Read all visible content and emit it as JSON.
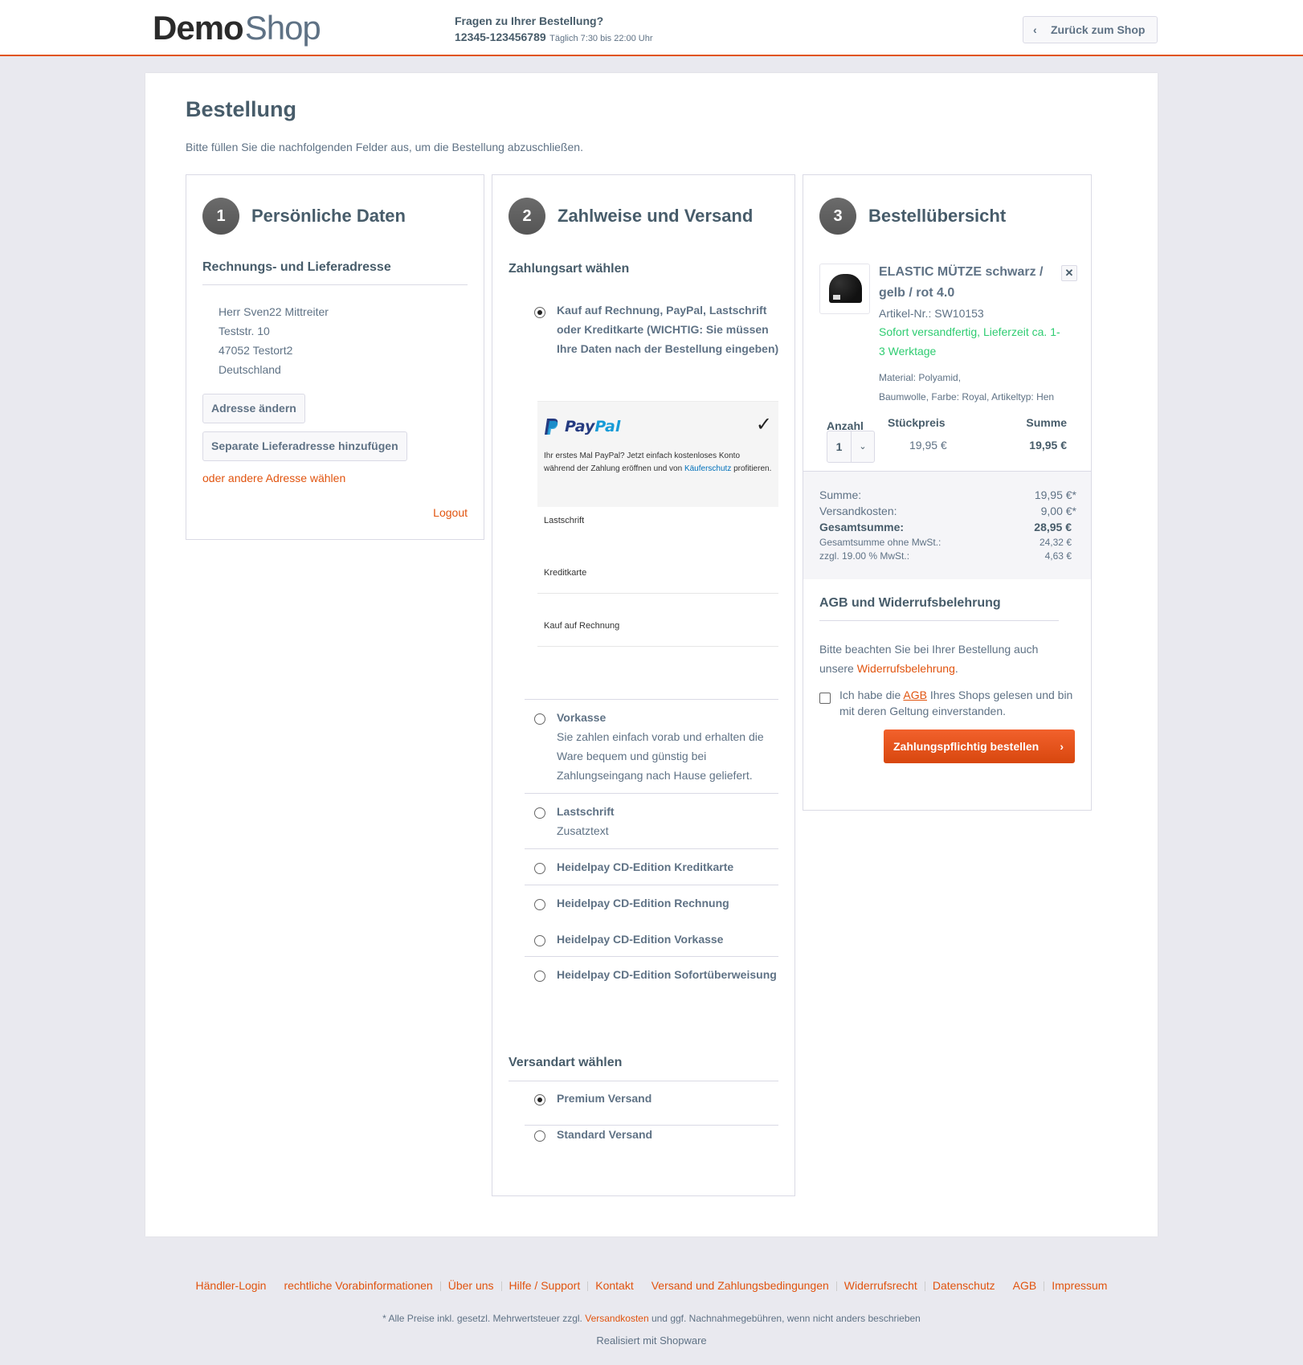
{
  "header": {
    "logo_bold": "Demo",
    "logo_light": "Shop",
    "hotline_question": "Fragen zu Ihrer Bestellung?",
    "hotline_number": "12345-123456789",
    "hotline_hours": "Täglich 7:30 bis 22:00 Uhr",
    "back_button": "Zurück zum Shop",
    "back_icon": "chevron-left-icon",
    "accent_color": "#e1540f"
  },
  "page": {
    "title": "Bestellung",
    "subtitle": "Bitte füllen Sie die nachfolgenden Felder aus, um die Bestellung abzuschließen."
  },
  "personal": {
    "step": "1",
    "title": "Persönliche Daten",
    "section": "Rechnungs- und Lieferadresse",
    "address": [
      "Herr Sven22 Mittreiter",
      "Teststr. 10",
      "47052 Testort2",
      "Deutschland"
    ],
    "change_address": "Adresse ändern",
    "add_shipping": "Separate Lieferadresse hinzufügen",
    "other_address": "oder andere Adresse wählen",
    "logout": "Logout"
  },
  "payment": {
    "step": "2",
    "title": "Zahlweise und Versand",
    "section": "Zahlungsart wählen",
    "selected_method": {
      "label": "Kauf auf Rechnung, PayPal, Lastschrift oder Kreditkarte (WICHTIG: Sie müssen Ihre Daten nach der Bestellung eingeben)",
      "selected": true
    },
    "paypal": {
      "logo_pay": "Pay",
      "logo_pal": "Pal",
      "check_icon": "checkmark-icon",
      "text_before": "Ihr erstes Mal PayPal? Jetzt einfach kostenloses Konto während der Zahlung eröffnen und von ",
      "link": "Käuferschutz",
      "text_after": " profitieren.",
      "sub_options": [
        "Lastschrift",
        "Kreditkarte",
        "Kauf auf Rechnung"
      ]
    },
    "methods": [
      {
        "label": "Vorkasse",
        "desc": "Sie zahlen einfach vorab und erhalten die Ware bequem und günstig bei Zahlungseingang nach Hause geliefert.",
        "selected": false
      },
      {
        "label": "Lastschrift",
        "desc": "Zusatztext",
        "selected": false
      },
      {
        "label": "Heidelpay CD-Edition Kreditkarte",
        "selected": false
      },
      {
        "label": "Heidelpay CD-Edition Rechnung",
        "selected": false
      },
      {
        "label": "Heidelpay CD-Edition Vorkasse",
        "selected": false
      },
      {
        "label": "Heidelpay CD-Edition Sofortüberweisung",
        "selected": false
      }
    ],
    "shipping_section": "Versandart wählen",
    "shipping": [
      {
        "label": "Premium Versand",
        "selected": true
      },
      {
        "label": "Standard Versand",
        "selected": false
      }
    ]
  },
  "summary": {
    "step": "3",
    "title": "Bestellübersicht",
    "product": {
      "name": "ELASTIC MÜTZE schwarz / gelb / rot 4.0",
      "sku": "Artikel-Nr.: SW10153",
      "delivery": "Sofort versandfertig, Lieferzeit ca. 1-3 Werktage",
      "props_line1": "Material: Polyamid,",
      "props_line2": "Baumwolle, Farbe: Royal, Artikeltyp: Hen",
      "remove_icon": "close-icon",
      "image_icon": "beanie-hat-image"
    },
    "col_qty": "Anzahl",
    "col_unit": "Stückpreis",
    "col_sum": "Summe",
    "quantity": "1",
    "unit_price": "19,95 €",
    "line_total": "19,95 €",
    "totals": {
      "sum_label": "Summe:",
      "sum_value": "19,95 €*",
      "shipping_label": "Versandkosten:",
      "shipping_value": "9,00 €*",
      "grand_label": "Gesamtsumme:",
      "grand_value": "28,95 €",
      "net_label": "Gesamtsumme ohne MwSt.:",
      "net_value": "24,32 €",
      "tax_label": "zzgl. 19.00 % MwSt.:",
      "tax_value": "4,63 €"
    },
    "agb_title": "AGB und Widerrufsbelehrung",
    "agb_note_before": "Bitte beachten Sie bei Ihrer Bestellung auch unsere ",
    "agb_note_link": "Widerrufsbelehrung",
    "agb_note_after": ".",
    "agb_check_before": "Ich habe die ",
    "agb_check_link": "AGB",
    "agb_check_after": " Ihres Shops gelesen und bin mit deren Geltung einverstanden.",
    "agb_checked": false,
    "order_button": "Zahlungspflichtig bestellen"
  },
  "footer": {
    "links": [
      "Händler-Login",
      "rechtliche Vorabinformationen",
      "Über uns",
      "Hilfe / Support",
      "Kontakt",
      "Versand und Zahlungsbedingungen",
      "Widerrufsrecht",
      "Datenschutz",
      "AGB",
      "Impressum"
    ],
    "note_before": "* Alle Preise inkl. gesetzl. Mehrwertsteuer zzgl. ",
    "note_link": "Versandkosten",
    "note_after": " und ggf. Nachnahmegebühren, wenn nicht anders beschrieben",
    "made_with": "Realisiert mit Shopware"
  }
}
